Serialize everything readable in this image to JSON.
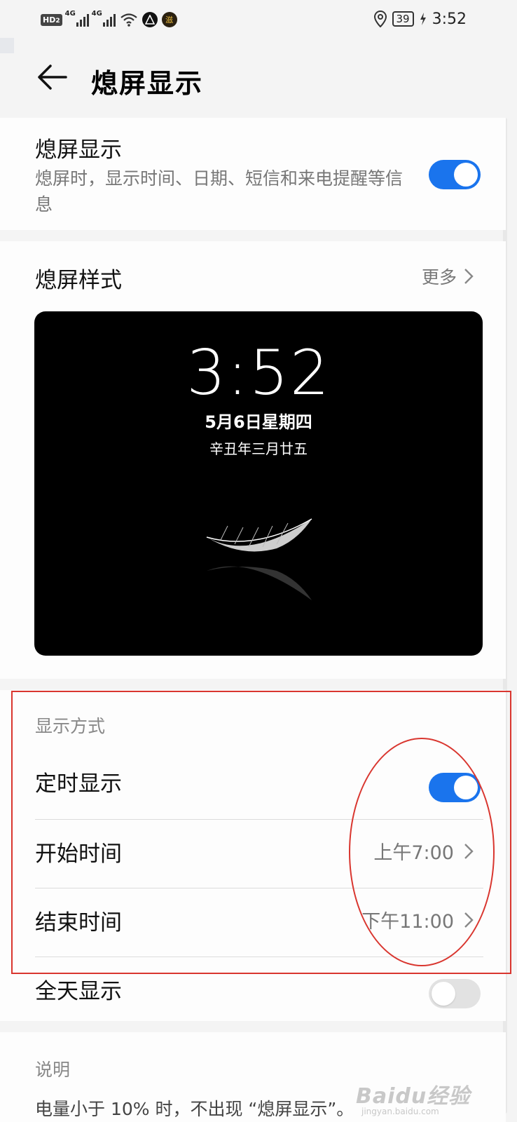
{
  "status_bar": {
    "hd_label": "HD",
    "hd_sub": "2",
    "signal1_label": "4G",
    "signal2_label": "4G",
    "badge_gold": "滋",
    "battery": "39",
    "time": "3:52"
  },
  "header": {
    "title": "熄屏显示"
  },
  "aod_toggle": {
    "title": "熄屏显示",
    "subtitle": "熄屏时，显示时间、日期、短信和来电提醒等信息",
    "on": true
  },
  "style_section": {
    "title": "熄屏样式",
    "more_label": "更多",
    "preview": {
      "time": "3:52",
      "date": "5月6日星期四",
      "lunar": "辛丑年三月廿五"
    }
  },
  "display_mode": {
    "group_label": "显示方式",
    "scheduled_label": "定时显示",
    "scheduled_on": true,
    "start_label": "开始时间",
    "start_value": "上午7:00",
    "end_label": "结束时间",
    "end_value": "下午11:00",
    "all_day_label": "全天显示",
    "all_day_on": false
  },
  "notes": {
    "label": "说明",
    "text": "电量小于 10% 时，不出现 “熄屏显示”。"
  },
  "watermark": {
    "main": "Baidu经验",
    "sub": "jingyan.baidu.com"
  },
  "colors": {
    "accent": "#1a74ed",
    "annotation": "#d9362f"
  }
}
